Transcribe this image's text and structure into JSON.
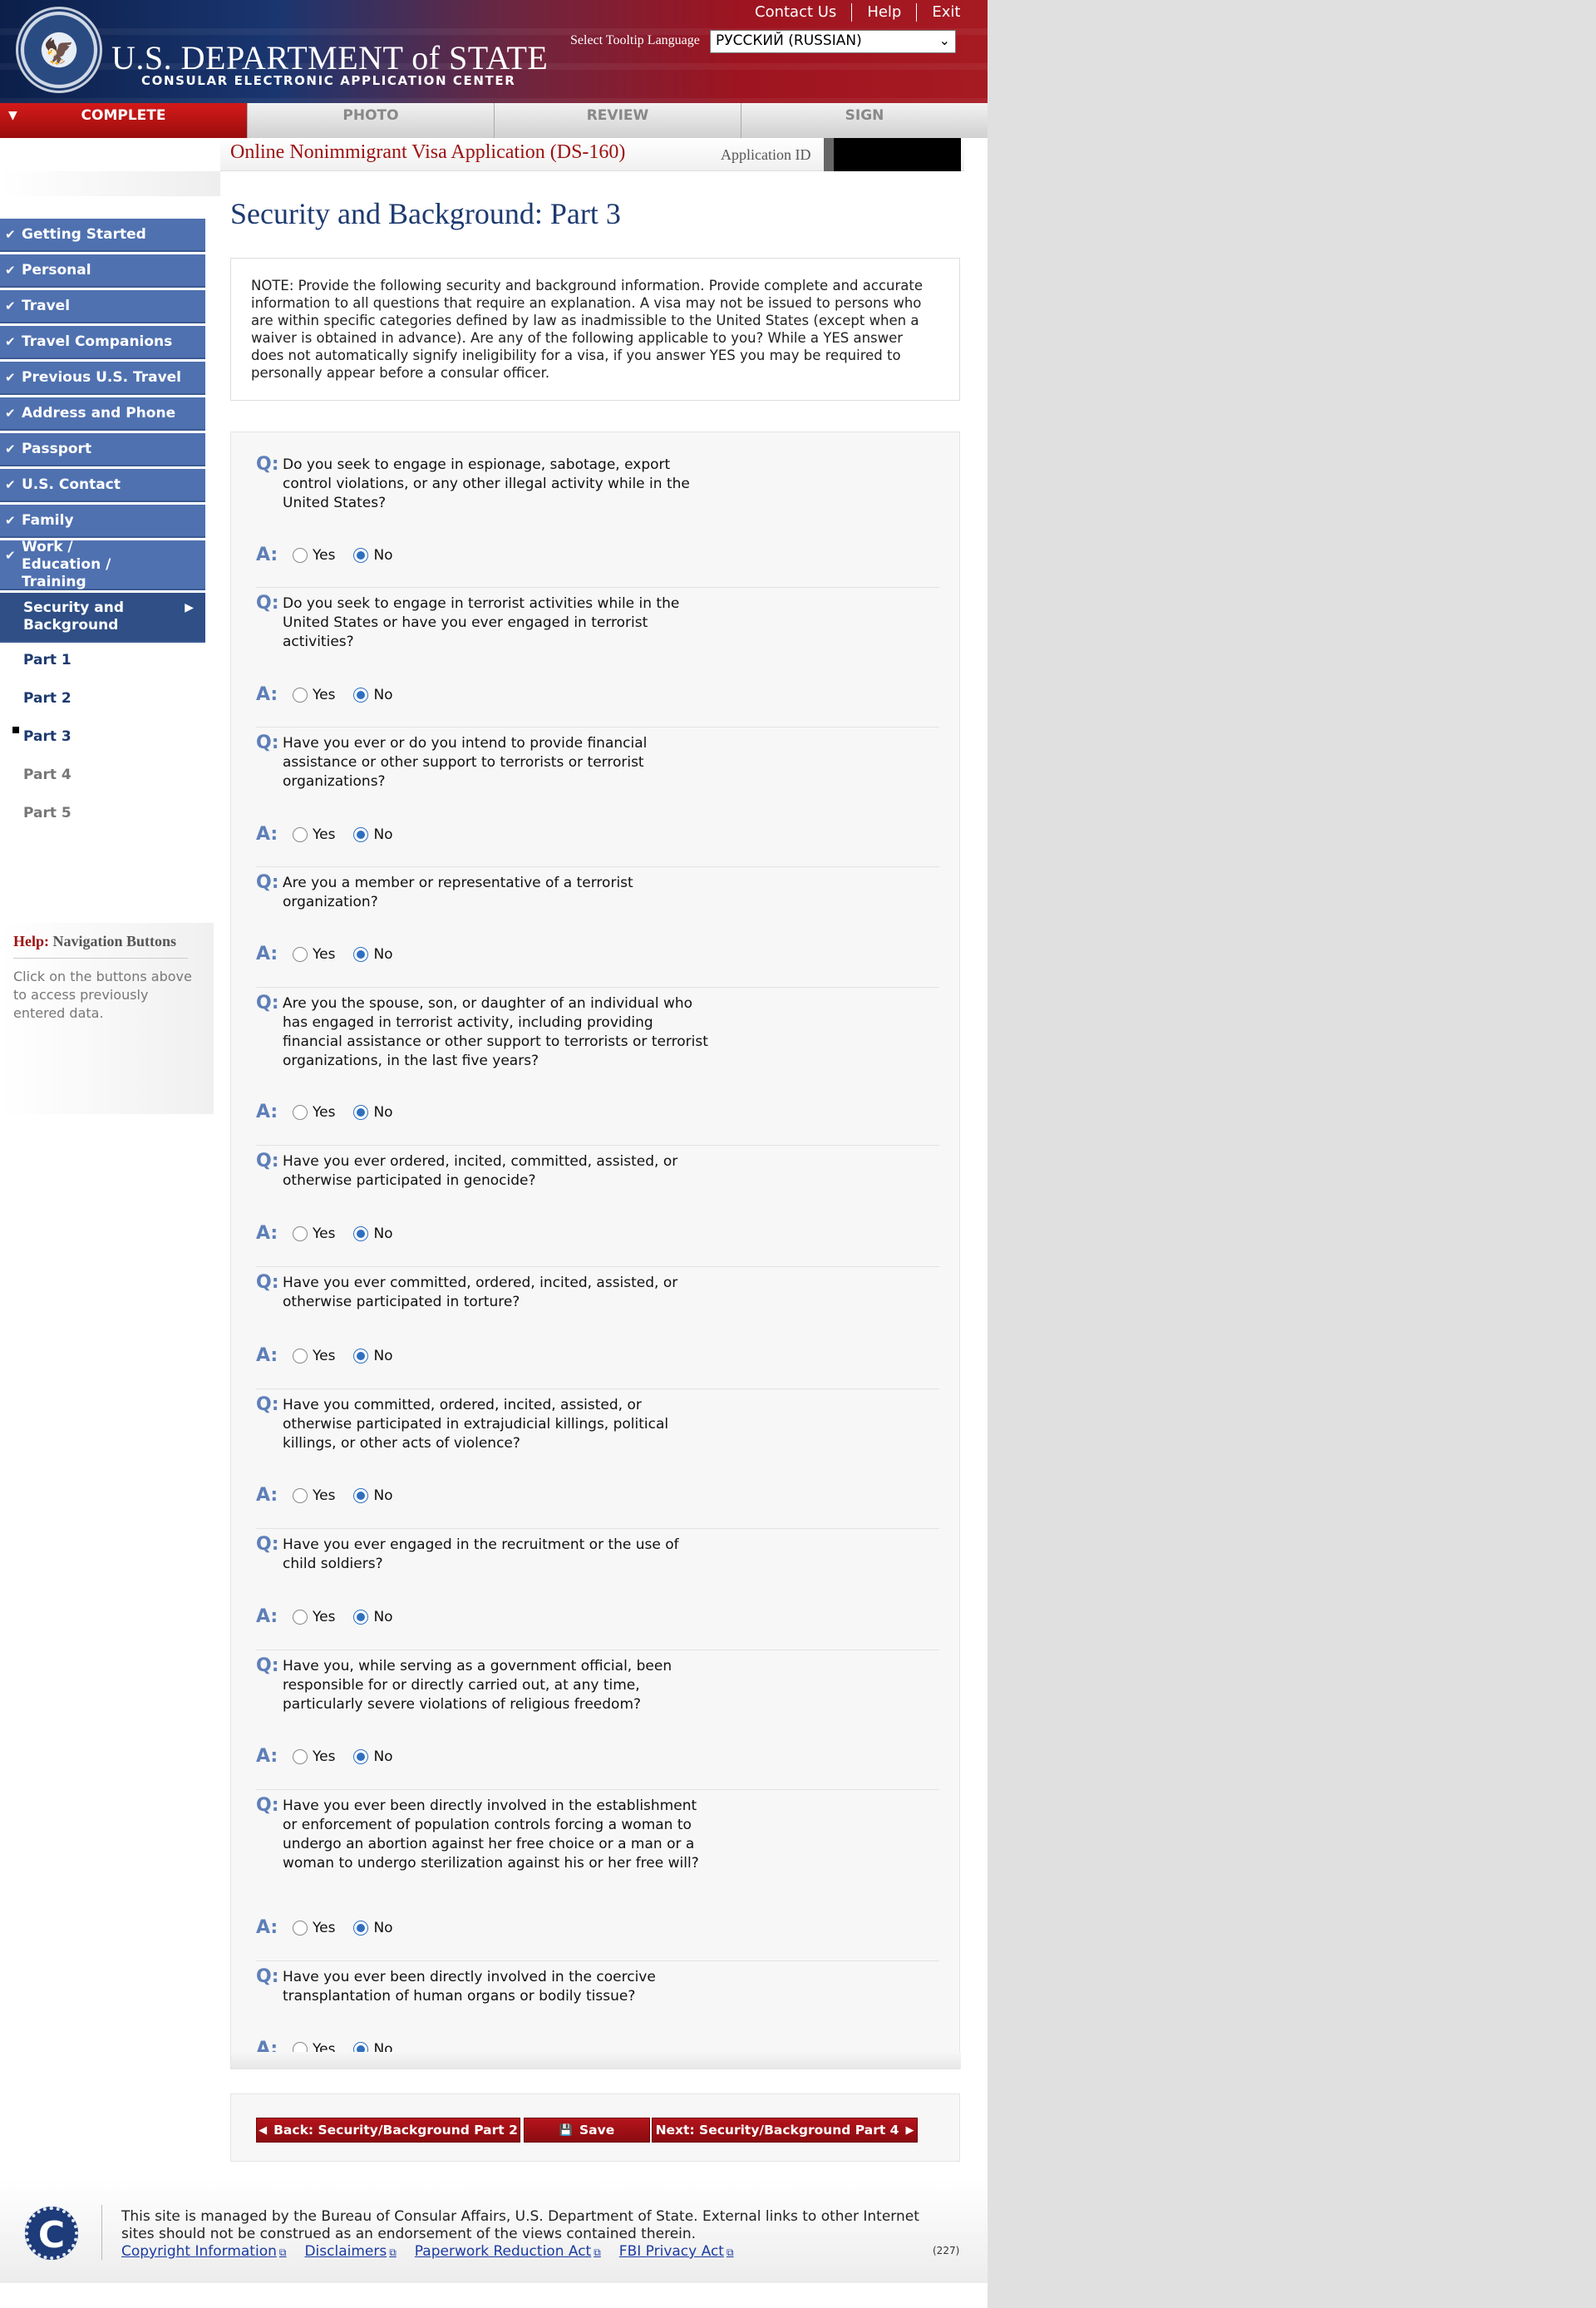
{
  "header": {
    "brand": "U.S. DEPARTMENT of STATE",
    "brand_sub": "CONSULAR ELECTRONIC APPLICATION CENTER",
    "links": [
      "Contact Us",
      "Help",
      "Exit"
    ],
    "language_label": "Select Tooltip Language",
    "language_value": "РУССКИЙ (RUSSIAN)"
  },
  "steps": [
    "COMPLETE",
    "PHOTO",
    "REVIEW",
    "SIGN"
  ],
  "app": {
    "title": "Online Nonimmigrant Visa Application (DS-160)",
    "id_label": "Application ID"
  },
  "sidebar": {
    "items": [
      "Getting Started",
      "Personal",
      "Travel",
      "Travel Companions",
      "Previous U.S. Travel",
      "Address and Phone",
      "Passport",
      "U.S. Contact",
      "Family",
      "Work / Education / Training",
      "Security and Background"
    ],
    "subitems": [
      "Part 1",
      "Part 2",
      "Part 3",
      "Part 4",
      "Part 5"
    ],
    "help_label": "Help:",
    "help_topic": "Navigation Buttons",
    "help_text": "Click on the buttons above to access previously entered data."
  },
  "main": {
    "title": "Security and Background: Part 3",
    "note": "NOTE: Provide the following security and background information. Provide complete and accurate information to all questions that require an explanation. A visa may not be issued to persons who are within specific categories defined by law as inadmissible to the United States (except when a waiver is obtained in advance). Are any of the following applicable to you? While a YES answer does not automatically signify ineligibility for a visa, if you answer YES you may be required to personally appear before a consular officer.",
    "q_label": "Q:",
    "a_label": "A:",
    "yes": "Yes",
    "no": "No",
    "questions": [
      "Do you seek to engage in espionage, sabotage, export control violations, or any other illegal activity while in the United States?",
      "Do you seek to engage in terrorist activities while in the United States or have you ever engaged in terrorist activities?",
      "Have you ever or do you intend to provide financial assistance or other support to terrorists or terrorist organizations?",
      "Are you a member or representative of a terrorist organization?",
      "Are you the spouse, son, or daughter of an individual who has engaged in terrorist activity, including providing financial assistance or other support to terrorists or terrorist organizations, in the last five years?",
      "Have you ever ordered, incited, committed, assisted, or otherwise participated in genocide?",
      "Have you ever committed, ordered, incited, assisted, or otherwise participated in torture?",
      "Have you committed, ordered, incited, assisted, or otherwise participated in extrajudicial killings, political killings, or other acts of violence?",
      "Have you ever engaged in the recruitment or the use of child soldiers?",
      "Have you, while serving as a government official, been responsible for or directly carried out, at any time, particularly severe violations of religious freedom?",
      "Have you ever been directly involved in the establishment or enforcement of population controls forcing a woman to undergo an abortion against her free choice or a man or a woman to undergo sterilization against his or her free will?",
      "Have you ever been directly involved in the coercive transplantation of human organs or bodily tissue?"
    ],
    "selected": [
      "No",
      "No",
      "No",
      "No",
      "No",
      "No",
      "No",
      "No",
      "No",
      "No",
      "No",
      "No"
    ]
  },
  "buttons": {
    "back": "Back: Security/Background Part 2",
    "save": "Save",
    "next": "Next: Security/Background Part 4"
  },
  "footer": {
    "logo": "C",
    "text": "This site is managed by the Bureau of Consular Affairs, U.S. Department of State. External links to other Internet sites should not be construed as an endorsement of the views contained therein.",
    "links": [
      "Copyright Information",
      "Disclaimers",
      "Paperwork Reduction Act",
      "FBI Privacy Act"
    ],
    "build": "(227)"
  }
}
